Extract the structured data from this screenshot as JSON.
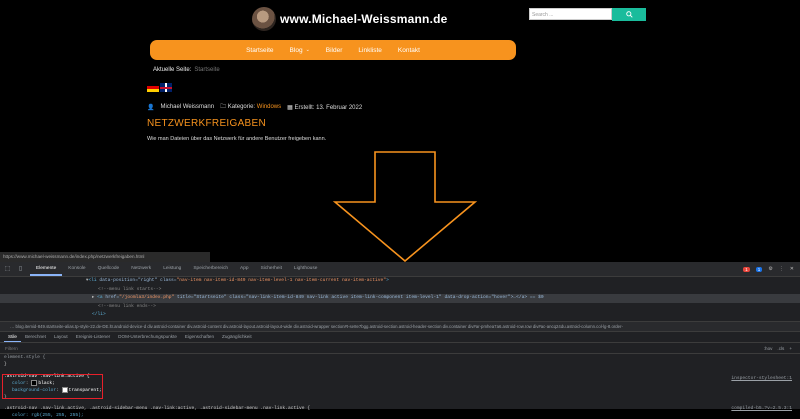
{
  "site": {
    "title": "www.Michael-Weissmann.de",
    "search_placeholder": "Search ...",
    "nav": [
      "Startseite",
      "Blog",
      "Bilder",
      "Linkliste",
      "Kontakt"
    ],
    "breadcrumb_label": "Aktuelle Seite:",
    "breadcrumb_current": "Startseite",
    "meta_author": "Michael Weissmann",
    "meta_category_label": "Kategorie:",
    "meta_category": "Windows",
    "meta_date": "Erstellt: 13. Februar 2022",
    "post_title": "NETZWERKFREIGABEN",
    "post_excerpt": "Wie man Dateien über das Netzwerk für andere Benutzer freigeben kann.",
    "status_url": "https://www.michael-weissmann.de/index.php/netzwerkfreigaben.html",
    "accent_color": "#f7931e",
    "search_button_color": "#1abc9c"
  },
  "devtools": {
    "tabs": [
      "Elemente",
      "Konsole",
      "Quellcode",
      "Netzwerk",
      "Leistung",
      "Speicherbereich",
      "App",
      "Sicherheit",
      "Lighthouse"
    ],
    "active_tab": "Elemente",
    "error_count": "1",
    "issue_count": "1",
    "dom": {
      "line1_tag": "<li",
      "line1_attr": " data-position=\"right\" class=",
      "line1_val": "\"nav-item nav-item-id-849 nav-item-level-1 nav-item-current nav-item-active\"",
      "line1_end": ">",
      "line2": "<!--menu link starts-->",
      "line3_tag": "<a",
      "line3_attr": " href=",
      "line3_val": "\"/joomla3/index.php\"",
      "line3_rest": " title=\"Startseite\" class=\"nav-link-item-id-849 nav-link active item-link-component item-level-1\" data-drop-action=\"hover\">…</a> == $0",
      "line4": "<!--menu link ends-->",
      "line5": "</li>"
    },
    "breadcrumbs": "… blog.itemid-849.startseite-alias.tp-style-22.de-DE.ltr.android-device-d   div.astroid-container   div.astroid-content   div.astroid-layout.astroid-layout-wide   div.astroid-wrapper   section#t-se8e7bgg.astroid-section.astroid-header-section   div.container   div#ar-pmhea7a6.astroid-row.row   div#ac-ancq24du.astroid-column.col-lg-8.order-",
    "pane_tabs": [
      "Stile",
      "Berechnet",
      "Layout",
      "Ereignis-Listener",
      "DOM-Unterbrechungspunkte",
      "Eigenschaften",
      "Zugänglichkeit"
    ],
    "filter_placeholder": "Filtern",
    "filter_tools": [
      ":hov",
      ".cls",
      "+"
    ],
    "rules": {
      "element_style": "element.style {",
      "close": "}",
      "selector1": ".astroid-nav .nav-link.active {",
      "color_prop": "color",
      "color_val": "black;",
      "bg_prop": "background-color",
      "bg_val": "transparent;",
      "source1": "inspector-stylesheet:1",
      "selector2": ".astroid-nav .nav-link.active, .astroid-sidebar-menu .nav-link:active, .astroid-sidebar-menu .nav-link.active {",
      "color2": "color: rgb(255, 255, 255);",
      "source2": "compiled-b5…?v=2.5.3:1"
    }
  }
}
